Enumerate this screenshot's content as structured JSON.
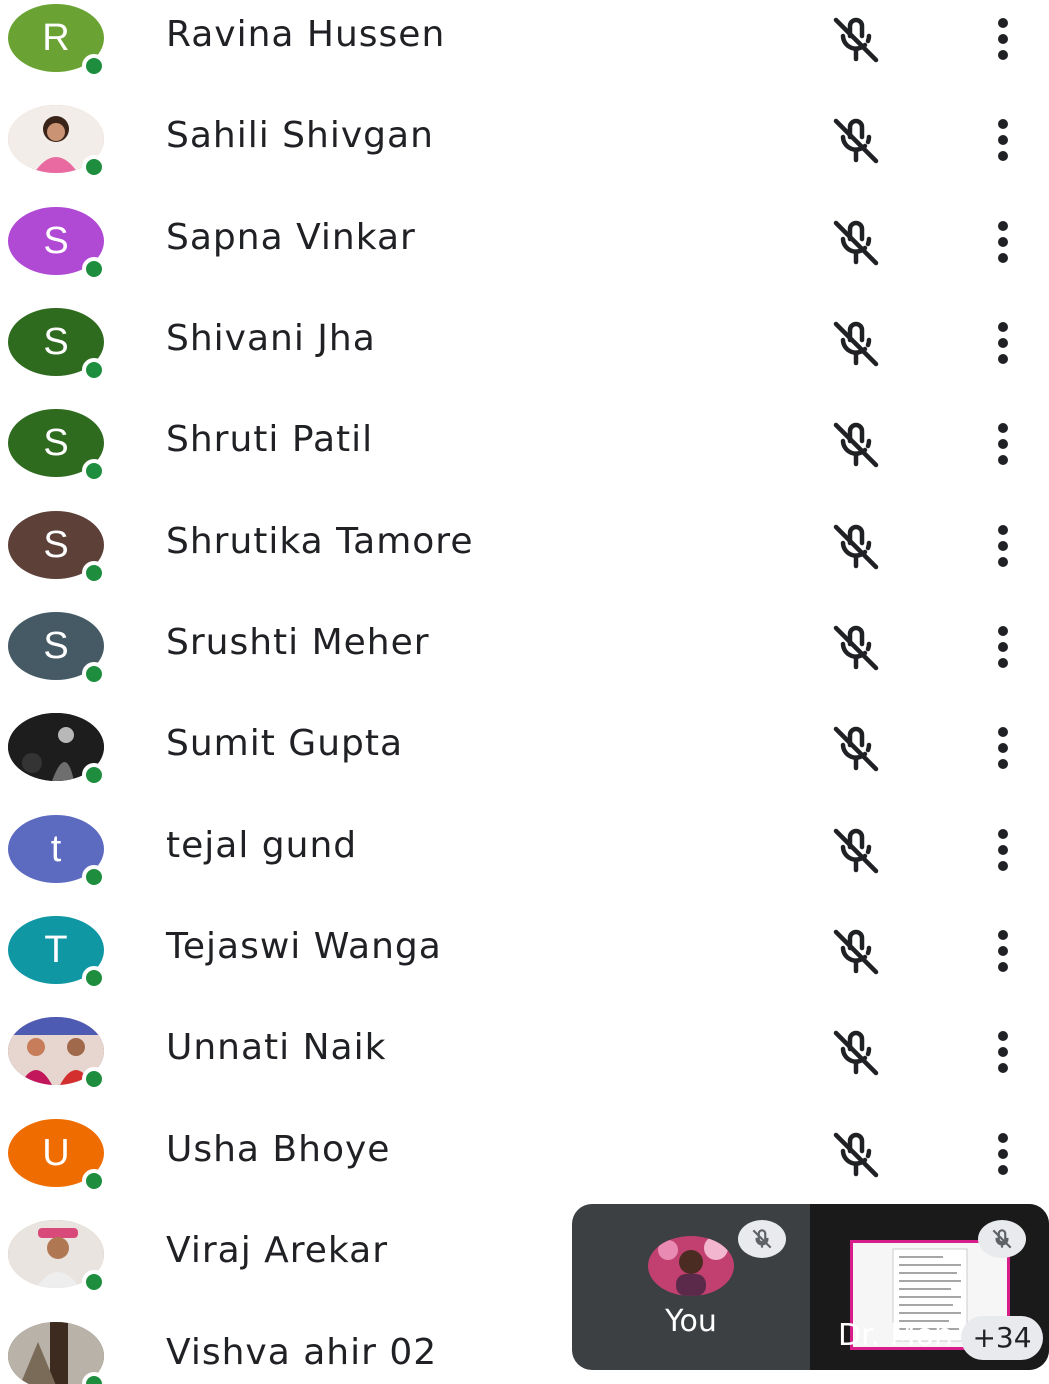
{
  "participants": [
    {
      "name": "Ravina Hussen",
      "initial": "R",
      "color": "#6aa333",
      "photo": false
    },
    {
      "name": "Sahili Shivgan",
      "initial": "",
      "color": "#c9a48f",
      "photo": true
    },
    {
      "name": "Sapna Vinkar",
      "initial": "S",
      "color": "#b049d4",
      "photo": false
    },
    {
      "name": "Shivani Jha",
      "initial": "S",
      "color": "#2f6b1f",
      "photo": false
    },
    {
      "name": "Shruti Patil",
      "initial": "S",
      "color": "#2f6b1f",
      "photo": false
    },
    {
      "name": "Shrutika Tamore",
      "initial": "S",
      "color": "#5d4037",
      "photo": false
    },
    {
      "name": "Srushti Meher",
      "initial": "S",
      "color": "#455a64",
      "photo": false
    },
    {
      "name": "Sumit Gupta",
      "initial": "",
      "color": "#2b2b2b",
      "photo": true
    },
    {
      "name": "tejal gund",
      "initial": "t",
      "color": "#5c6bc0",
      "photo": false
    },
    {
      "name": "Tejaswi Wanga",
      "initial": "T",
      "color": "#0f97a3",
      "photo": false
    },
    {
      "name": "Unnati Naik",
      "initial": "",
      "color": "#8e5a7a",
      "photo": true
    },
    {
      "name": "Usha Bhoye",
      "initial": "U",
      "color": "#ef6c00",
      "photo": false
    },
    {
      "name": "Viraj Arekar",
      "initial": "",
      "color": "#a89a8c",
      "photo": true
    },
    {
      "name": "Vishva ahir 02",
      "initial": "",
      "color": "#6d5b4a",
      "photo": true
    }
  ],
  "pip": {
    "you_label": "You",
    "presenter_name": "Dr. Moh",
    "more_count": "+34"
  },
  "icons": {
    "mic": "mic-off-icon",
    "more": "more-vert-icon",
    "online": "online-status-dot"
  },
  "colors": {
    "online": "#1e8e3e",
    "text": "#202124",
    "pip_bg": "#3c4043"
  }
}
